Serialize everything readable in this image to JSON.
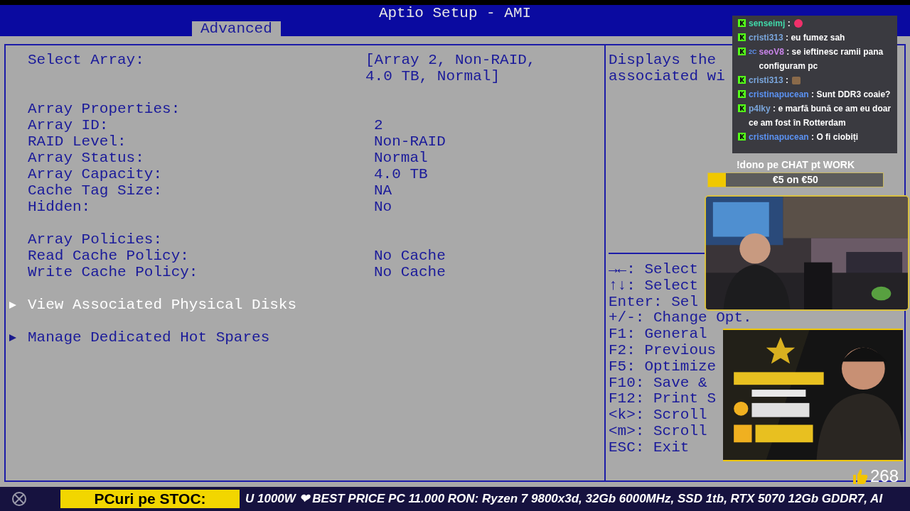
{
  "header": {
    "title": "Aptio Setup - AMI",
    "tabs": [
      {
        "label": "Advanced",
        "selected": true
      }
    ]
  },
  "settings_sections": [
    {
      "items": [
        {
          "kind": "select",
          "label": "Select Array:",
          "value": "[Array 2, Non-RAID, 4.0 TB, Normal]"
        }
      ]
    },
    {
      "items": [
        {
          "kind": "heading",
          "label": "Array Properties:"
        },
        {
          "kind": "setting",
          "label": "Array ID:",
          "value": "2"
        },
        {
          "kind": "setting",
          "label": "RAID Level:",
          "value": "Non-RAID"
        },
        {
          "kind": "setting",
          "label": "Array Status:",
          "value": "Normal"
        },
        {
          "kind": "setting",
          "label": "Array Capacity:",
          "value": "4.0 TB"
        },
        {
          "kind": "setting",
          "label": "Cache Tag Size:",
          "value": "NA"
        },
        {
          "kind": "setting",
          "label": "Hidden:",
          "value": "No"
        }
      ]
    },
    {
      "items": [
        {
          "kind": "heading",
          "label": "Array Policies:"
        },
        {
          "kind": "setting",
          "label": "Read Cache Policy:",
          "value": "No Cache"
        },
        {
          "kind": "setting",
          "label": "Write Cache Policy:",
          "value": "No Cache"
        }
      ]
    },
    {
      "items": [
        {
          "kind": "submenu",
          "label": "View Associated Physical Disks",
          "selected": true
        }
      ]
    },
    {
      "items": [
        {
          "kind": "submenu",
          "label": "Manage Dedicated Hot Spares",
          "selected": false
        }
      ]
    }
  ],
  "help_panel": {
    "description_lines": [
      "Displays the",
      "associated wi"
    ],
    "keys": [
      "→←: Select",
      "↑↓: Select",
      "Enter: Sel",
      "+/-: Change Opt.",
      "F1: General",
      "F2: Previous",
      "F5: Optimize",
      "F10: Save &",
      "F12: Print S",
      "<k>: Scroll",
      "<m>: Scroll",
      "ESC: Exit"
    ]
  },
  "stream_overlay": {
    "chat": [
      {
        "kind": "emote",
        "user": "senseimj",
        "color": "#40d8a8",
        "separator": ":"
      },
      {
        "kind": "text",
        "user": "cristi313",
        "color": "#7aa6dc",
        "separator": ":",
        "text": "eu fumez sah"
      },
      {
        "kind": "text",
        "user": "seoV8",
        "color": "#c884e8",
        "badge": "2C",
        "separator": ":",
        "text": "se ieftinesc ramii pana configuram pc"
      },
      {
        "kind": "emote",
        "user": "cristi313",
        "color": "#7aa6dc",
        "separator": ":"
      },
      {
        "kind": "text",
        "user": "cristinapucean",
        "color": "#5b92f2",
        "separator": ":",
        "text": "Sunt DDR3 coaie?"
      },
      {
        "kind": "text",
        "user": "p4lky",
        "color": "#7aa6dc",
        "separator": ":",
        "text": "e marfă bună ce am eu doar ce am fost în Rotterdam"
      },
      {
        "kind": "text",
        "user": "cristinapucean",
        "color": "#5b92f2",
        "separator": ":",
        "text": "O fi ciobiți"
      }
    ],
    "donation": {
      "title": "!dono pe CHAT pt WORK",
      "progress": "€5 on €50",
      "level": 0.1
    },
    "likes": "268",
    "ticker": {
      "label": "PCuri pe STOC:",
      "text": "U 1000W ❤ BEST PRICE PC 11.000 RON: Ryzen 7 9800x3d, 32Gb 6000MHz, SSD 1tb, RTX 5070 12Gb GDDR7, AI"
    }
  }
}
